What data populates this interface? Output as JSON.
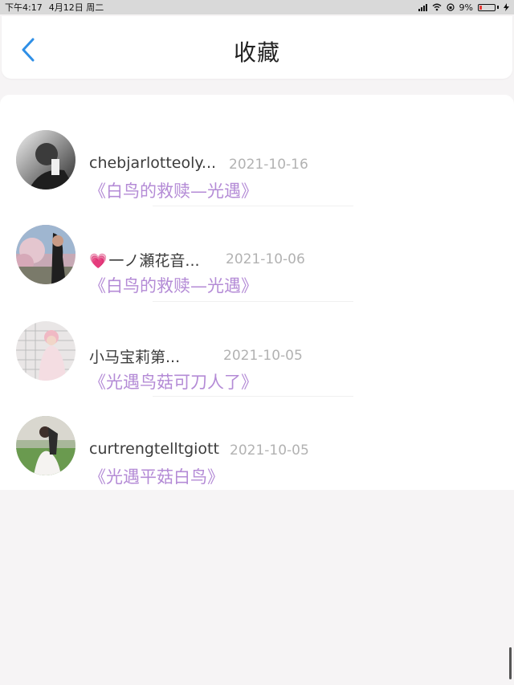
{
  "status_bar": {
    "time": "下午4:17",
    "date": "4月12日 周二",
    "battery": "9%"
  },
  "header": {
    "title": "收藏",
    "back_icon": "chevron-left-icon"
  },
  "colors": {
    "accent_back": "#2f8fe6",
    "work_title": "#b48bd6",
    "date_text": "#b2b2b2",
    "heart": "#e0479c"
  },
  "favorites": [
    {
      "name": "chebjarlotteoly...",
      "date": "2021-10-16",
      "work": "《白鸟的救赎—光遇》"
    },
    {
      "name": "一ノ瀬花音...",
      "date": "2021-10-06",
      "work": "《白鸟的救赎—光遇》",
      "name_prefix": "💗"
    },
    {
      "name": "小马宝莉第...",
      "date": "2021-10-05",
      "work": "《光遇鸟菇可刀人了》"
    },
    {
      "name": "curtrengtelltgiott",
      "date": "2021-10-05",
      "work": "《光遇平菇白鸟》"
    }
  ]
}
